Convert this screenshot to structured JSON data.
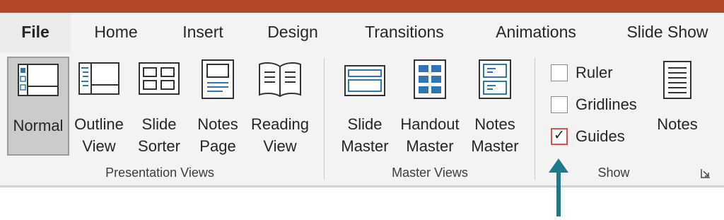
{
  "tabs": [
    {
      "label": "File",
      "active": true
    },
    {
      "label": "Home"
    },
    {
      "label": "Insert"
    },
    {
      "label": "Design"
    },
    {
      "label": "Transitions"
    },
    {
      "label": "Animations"
    },
    {
      "label": "Slide Show"
    }
  ],
  "presentation_views": {
    "group_label": "Presentation Views",
    "buttons": [
      {
        "line1": "Normal",
        "line2": "",
        "icon": "normal-view-icon",
        "active": true
      },
      {
        "line1": "Outline",
        "line2": "View",
        "icon": "outline-view-icon"
      },
      {
        "line1": "Slide",
        "line2": "Sorter",
        "icon": "slide-sorter-icon"
      },
      {
        "line1": "Notes",
        "line2": "Page",
        "icon": "notes-page-icon"
      },
      {
        "line1": "Reading",
        "line2": "View",
        "icon": "reading-view-icon"
      }
    ]
  },
  "master_views": {
    "group_label": "Master Views",
    "buttons": [
      {
        "line1": "Slide",
        "line2": "Master",
        "icon": "slide-master-icon"
      },
      {
        "line1": "Handout",
        "line2": "Master",
        "icon": "handout-master-icon"
      },
      {
        "line1": "Notes",
        "line2": "Master",
        "icon": "notes-master-icon"
      }
    ]
  },
  "show": {
    "group_label": "Show",
    "ruler": {
      "label": "Ruler",
      "checked": false
    },
    "gridlines": {
      "label": "Gridlines",
      "checked": false
    },
    "guides": {
      "label": "Guides",
      "checked": true
    },
    "notes_label": "Notes"
  },
  "colors": {
    "title_bar": "#b7472a",
    "accent_blue": "#2e75b6",
    "highlight_red": "#e0514a",
    "arrow_teal": "#1c7a8c"
  }
}
